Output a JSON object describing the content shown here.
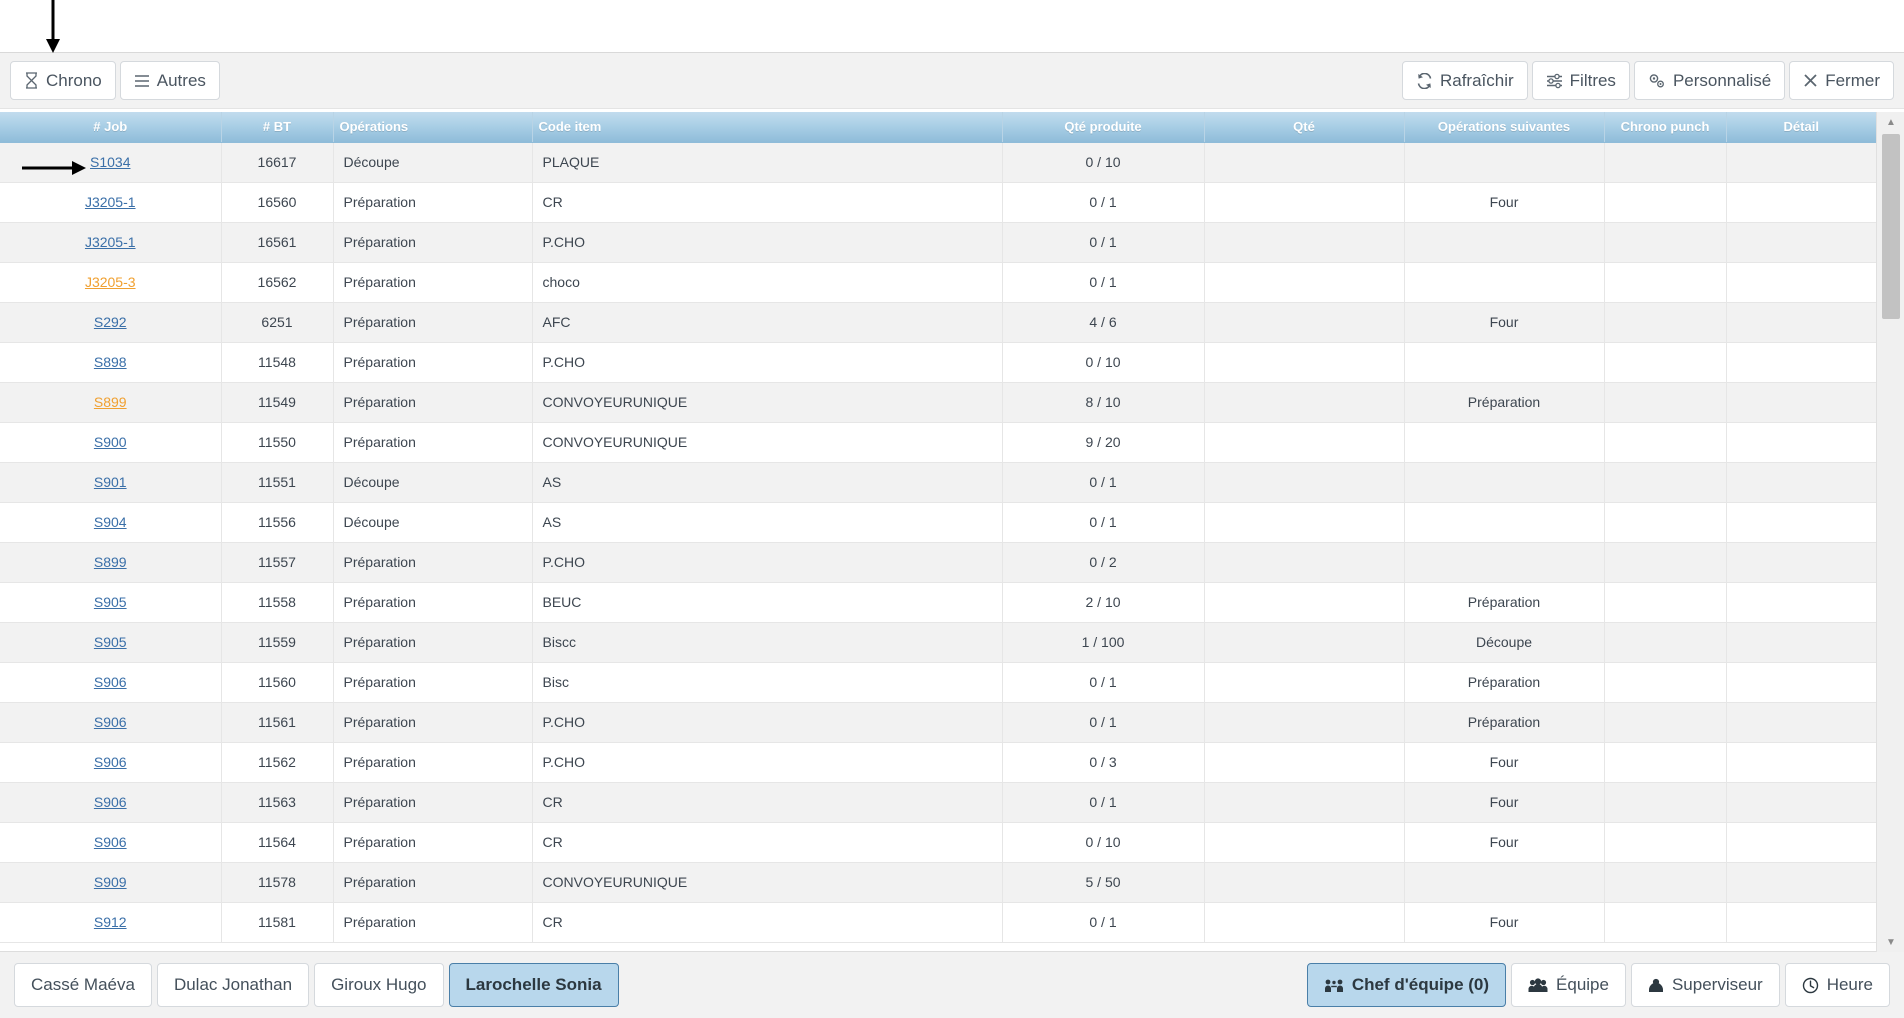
{
  "toolbar": {
    "left_buttons": [
      {
        "label": "Chrono",
        "icon": "hourglass-icon"
      },
      {
        "label": "Autres",
        "icon": "hamburger-icon"
      }
    ],
    "right_buttons": [
      {
        "label": "Rafraîchir",
        "icon": "refresh-icon"
      },
      {
        "label": "Filtres",
        "icon": "filter-sliders-icon"
      },
      {
        "label": "Personnalisé",
        "icon": "gears-icon"
      },
      {
        "label": "Fermer",
        "icon": "close-icon"
      }
    ]
  },
  "table": {
    "columns": [
      "# Job",
      "# BT",
      "Opérations",
      "Code item",
      "Qté produite",
      "Qté",
      "Opérations suivantes",
      "Chrono punch",
      "Détail"
    ],
    "rows": [
      {
        "job": "S1034",
        "bt": "16617",
        "op": "Découpe",
        "item": "PLAQUE",
        "produite": "0 / 10",
        "qte": "",
        "next": "",
        "chrono": "",
        "detail": "",
        "highlight": false
      },
      {
        "job": "J3205-1",
        "bt": "16560",
        "op": "Préparation",
        "item": "CR",
        "produite": "0 / 1",
        "qte": "",
        "next": "Four",
        "chrono": "",
        "detail": "",
        "highlight": false
      },
      {
        "job": "J3205-1",
        "bt": "16561",
        "op": "Préparation",
        "item": "P.CHO",
        "produite": "0 / 1",
        "qte": "",
        "next": "",
        "chrono": "",
        "detail": "",
        "highlight": false
      },
      {
        "job": "J3205-3",
        "bt": "16562",
        "op": "Préparation",
        "item": "choco",
        "produite": "0 / 1",
        "qte": "",
        "next": "",
        "chrono": "",
        "detail": "",
        "highlight": true
      },
      {
        "job": "S292",
        "bt": "6251",
        "op": "Préparation",
        "item": "AFC",
        "produite": "4 / 6",
        "qte": "",
        "next": "Four",
        "chrono": "",
        "detail": "",
        "highlight": false
      },
      {
        "job": "S898",
        "bt": "11548",
        "op": "Préparation",
        "item": "P.CHO",
        "produite": "0 / 10",
        "qte": "",
        "next": "",
        "chrono": "",
        "detail": "",
        "highlight": false
      },
      {
        "job": "S899",
        "bt": "11549",
        "op": "Préparation",
        "item": "CONVOYEURUNIQUE",
        "produite": "8 / 10",
        "qte": "",
        "next": "Préparation",
        "chrono": "",
        "detail": "",
        "highlight": true
      },
      {
        "job": "S900",
        "bt": "11550",
        "op": "Préparation",
        "item": "CONVOYEURUNIQUE",
        "produite": "9 / 20",
        "qte": "",
        "next": "",
        "chrono": "",
        "detail": "",
        "highlight": false
      },
      {
        "job": "S901",
        "bt": "11551",
        "op": "Découpe",
        "item": "AS",
        "produite": "0 / 1",
        "qte": "",
        "next": "",
        "chrono": "",
        "detail": "",
        "highlight": false
      },
      {
        "job": "S904",
        "bt": "11556",
        "op": "Découpe",
        "item": "AS",
        "produite": "0 / 1",
        "qte": "",
        "next": "",
        "chrono": "",
        "detail": "",
        "highlight": false
      },
      {
        "job": "S899",
        "bt": "11557",
        "op": "Préparation",
        "item": "P.CHO",
        "produite": "0 / 2",
        "qte": "",
        "next": "",
        "chrono": "",
        "detail": "",
        "highlight": false
      },
      {
        "job": "S905",
        "bt": "11558",
        "op": "Préparation",
        "item": "BEUC",
        "produite": "2 / 10",
        "qte": "",
        "next": "Préparation",
        "chrono": "",
        "detail": "",
        "highlight": false
      },
      {
        "job": "S905",
        "bt": "11559",
        "op": "Préparation",
        "item": "Biscc",
        "produite": "1 / 100",
        "qte": "",
        "next": "Découpe",
        "chrono": "",
        "detail": "",
        "highlight": false
      },
      {
        "job": "S906",
        "bt": "11560",
        "op": "Préparation",
        "item": "Bisc",
        "produite": "0 / 1",
        "qte": "",
        "next": "Préparation",
        "chrono": "",
        "detail": "",
        "highlight": false
      },
      {
        "job": "S906",
        "bt": "11561",
        "op": "Préparation",
        "item": "P.CHO",
        "produite": "0 / 1",
        "qte": "",
        "next": "Préparation",
        "chrono": "",
        "detail": "",
        "highlight": false
      },
      {
        "job": "S906",
        "bt": "11562",
        "op": "Préparation",
        "item": "P.CHO",
        "produite": "0 / 3",
        "qte": "",
        "next": "Four",
        "chrono": "",
        "detail": "",
        "highlight": false
      },
      {
        "job": "S906",
        "bt": "11563",
        "op": "Préparation",
        "item": "CR",
        "produite": "0 / 1",
        "qte": "",
        "next": "Four",
        "chrono": "",
        "detail": "",
        "highlight": false
      },
      {
        "job": "S906",
        "bt": "11564",
        "op": "Préparation",
        "item": "CR",
        "produite": "0 / 10",
        "qte": "",
        "next": "Four",
        "chrono": "",
        "detail": "",
        "highlight": false
      },
      {
        "job": "S909",
        "bt": "11578",
        "op": "Préparation",
        "item": "CONVOYEURUNIQUE",
        "produite": "5 / 50",
        "qte": "",
        "next": "",
        "chrono": "",
        "detail": "",
        "highlight": false
      },
      {
        "job": "S912",
        "bt": "11581",
        "op": "Préparation",
        "item": "CR",
        "produite": "0 / 1",
        "qte": "",
        "next": "Four",
        "chrono": "",
        "detail": "",
        "highlight": false
      }
    ]
  },
  "bottom_bar": {
    "employees": [
      {
        "label": "Cassé Maéva",
        "active": false
      },
      {
        "label": "Dulac Jonathan",
        "active": false
      },
      {
        "label": "Giroux Hugo",
        "active": false
      },
      {
        "label": "Larochelle Sonia",
        "active": true
      }
    ],
    "actions": [
      {
        "label": "Chef d'équipe (0)",
        "icon": "team-lead-icon",
        "active": true
      },
      {
        "label": "Équipe",
        "icon": "people-icon",
        "active": false
      },
      {
        "label": "Superviseur",
        "icon": "supervisor-icon",
        "active": false
      },
      {
        "label": "Heure",
        "icon": "clock-icon",
        "active": false
      }
    ]
  },
  "colors": {
    "highlight_orange": "#f0a030",
    "header_blue": "#8fbcd9",
    "link_blue": "#3a6fa8",
    "active_tab_bg": "#b8d7ec"
  }
}
